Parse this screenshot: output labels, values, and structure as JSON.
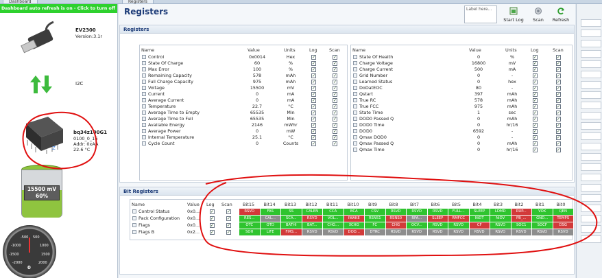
{
  "tabs": [
    {
      "label": "Dashboard"
    },
    {
      "label": "Registers"
    }
  ],
  "left": {
    "refresh_banner": "Dashboard auto refresh is on - Click to turn off",
    "adapter_name": "EV2300",
    "adapter_version": "Version:3.1r",
    "bus": "I2C",
    "chip_name": "bq34z100G1",
    "chip_rev": "0100_0_16",
    "chip_addr": "Addr: 0xAA",
    "chip_temp": "22.6 °C",
    "battery_voltage": "15500 mV",
    "battery_soc": "60%",
    "battery_level": 0.6,
    "gauge_labels": [
      "-500",
      "500",
      "-1000",
      "1000",
      "-1500",
      "1500",
      "-2000",
      "2000"
    ],
    "gauge_value": "0"
  },
  "main": {
    "title": "Registers",
    "label_placeholder": "Label here...",
    "start_log": "Start Log",
    "scan": "Scan",
    "refresh": "Refresh"
  },
  "registers": {
    "section_title": "Registers",
    "columns": [
      "Name",
      "Value",
      "Units",
      "Log",
      "Scan"
    ],
    "left_rows": [
      {
        "name": "Control",
        "value": "0x0014",
        "units": "Hex"
      },
      {
        "name": "State Of Charge",
        "value": "60",
        "units": "%"
      },
      {
        "name": "Max Error",
        "value": "100",
        "units": "%"
      },
      {
        "name": "Remaining Capacity",
        "value": "578",
        "units": "mAh"
      },
      {
        "name": "Full Charge Capacity",
        "value": "975",
        "units": "mAh"
      },
      {
        "name": "Voltage",
        "value": "15500",
        "units": "mV"
      },
      {
        "name": "Current",
        "value": "0",
        "units": "mA"
      },
      {
        "name": "Average Current",
        "value": "0",
        "units": "mA"
      },
      {
        "name": "Temperature",
        "value": "22.7",
        "units": "°C"
      },
      {
        "name": "Average Time to Empty",
        "value": "65535",
        "units": "Min"
      },
      {
        "name": "Average Time to Full",
        "value": "65535",
        "units": "Min"
      },
      {
        "name": "Available Energy",
        "value": "2146",
        "units": "mWhr"
      },
      {
        "name": "Average Power",
        "value": "0",
        "units": "mW"
      },
      {
        "name": "Internal Temperature",
        "value": "25.1",
        "units": "°C"
      },
      {
        "name": "Cycle Count",
        "value": "0",
        "units": "Counts"
      }
    ],
    "right_rows": [
      {
        "name": "State Of Health",
        "value": "0",
        "units": "%"
      },
      {
        "name": "Charge Voltage",
        "value": "16800",
        "units": "mV"
      },
      {
        "name": "Charge Current",
        "value": "500",
        "units": "mA"
      },
      {
        "name": "Grid Number",
        "value": "0",
        "units": "-"
      },
      {
        "name": "Learned Status",
        "value": "0",
        "units": "hex"
      },
      {
        "name": "DoDatEOC",
        "value": "80",
        "units": "-"
      },
      {
        "name": "Qstart",
        "value": "397",
        "units": "mAh"
      },
      {
        "name": "True RC",
        "value": "578",
        "units": "mAh"
      },
      {
        "name": "True FCC",
        "value": "975",
        "units": "mAh"
      },
      {
        "name": "State Time",
        "value": "1",
        "units": "sec"
      },
      {
        "name": "DOD0 Passed Q",
        "value": "0",
        "units": "mAh"
      },
      {
        "name": "DOD0 Time",
        "value": "0",
        "units": "hr/16"
      },
      {
        "name": "DOD0",
        "value": "6592",
        "units": "-"
      },
      {
        "name": "Qmax DOD0",
        "value": "0",
        "units": "-"
      },
      {
        "name": "Qmax Passed Q",
        "value": "0",
        "units": "mAh"
      },
      {
        "name": "Qmax Time",
        "value": "0",
        "units": "hr/16"
      }
    ]
  },
  "bit_registers": {
    "section_title": "Bit Registers",
    "columns": [
      "Name",
      "Value",
      "Log",
      "Scan",
      "Bit15",
      "Bit14",
      "Bit13",
      "Bit12",
      "Bit11",
      "Bit10",
      "Bit9",
      "Bit8",
      "Bit7",
      "Bit6",
      "Bit5",
      "Bit4",
      "Bit3",
      "Bit2",
      "Bit1",
      "Bit0"
    ],
    "rows": [
      {
        "name": "Control Status",
        "value": "0x0...",
        "bits": [
          {
            "t": "RSVD",
            "c": "r"
          },
          {
            "t": "FAS",
            "c": "g"
          },
          {
            "t": "SS",
            "c": "g"
          },
          {
            "t": "CALEN",
            "c": "g"
          },
          {
            "t": "CCA",
            "c": "g"
          },
          {
            "t": "BCA",
            "c": "g"
          },
          {
            "t": "CSV",
            "c": "g"
          },
          {
            "t": "RSVD",
            "c": "g"
          },
          {
            "t": "RSVD",
            "c": "g"
          },
          {
            "t": "RSVD",
            "c": "g"
          },
          {
            "t": "FULL...",
            "c": "g"
          },
          {
            "t": "SLEEP",
            "c": "g"
          },
          {
            "t": "LDMD",
            "c": "g"
          },
          {
            "t": "RUP...",
            "c": "r"
          },
          {
            "t": "VOK",
            "c": "g"
          },
          {
            "t": "QEN",
            "c": "g"
          }
        ]
      },
      {
        "name": "Pack Configuration",
        "value": "0x0...",
        "bits": [
          {
            "t": "RES...",
            "c": "g"
          },
          {
            "t": "CAL...",
            "c": "x"
          },
          {
            "t": "SCA...",
            "c": "g"
          },
          {
            "t": "RSVD",
            "c": "r"
          },
          {
            "t": "VOL...",
            "c": "g"
          },
          {
            "t": "IWAKE",
            "c": "r"
          },
          {
            "t": "RSNS1",
            "c": "g"
          },
          {
            "t": "RSNS0",
            "c": "r"
          },
          {
            "t": "RFA...",
            "c": "x"
          },
          {
            "t": "SLEEP",
            "c": "r"
          },
          {
            "t": "RMFCC",
            "c": "r"
          },
          {
            "t": "NiDT",
            "c": "g"
          },
          {
            "t": "NiDV",
            "c": "g"
          },
          {
            "t": "PB_...",
            "c": "r"
          },
          {
            "t": "GND...",
            "c": "g"
          },
          {
            "t": "TEMPS",
            "c": "r"
          }
        ]
      },
      {
        "name": "Flags",
        "value": "0x0...",
        "bits": [
          {
            "t": "OTC",
            "c": "g"
          },
          {
            "t": "OTD",
            "c": "g"
          },
          {
            "t": "BATHI",
            "c": "g"
          },
          {
            "t": "BAT...",
            "c": "g"
          },
          {
            "t": "CHG...",
            "c": "g"
          },
          {
            "t": "XCHG",
            "c": "g"
          },
          {
            "t": "FC",
            "c": "g"
          },
          {
            "t": "CHG",
            "c": "r"
          },
          {
            "t": "OCV...",
            "c": "g"
          },
          {
            "t": "RSVD",
            "c": "g"
          },
          {
            "t": "RSVD",
            "c": "g"
          },
          {
            "t": "CF",
            "c": "r"
          },
          {
            "t": "RSVD",
            "c": "g"
          },
          {
            "t": "SOC1",
            "c": "g"
          },
          {
            "t": "SOCF",
            "c": "g"
          },
          {
            "t": "DSG",
            "c": "r"
          }
        ]
      },
      {
        "name": "Flags B",
        "value": "0x2...",
        "bits": [
          {
            "t": "SOH",
            "c": "g"
          },
          {
            "t": "LIFE",
            "c": "g"
          },
          {
            "t": "FIRS...",
            "c": "r"
          },
          {
            "t": "RSVD",
            "c": "x"
          },
          {
            "t": "RSVD",
            "c": "x"
          },
          {
            "t": "DOD...",
            "c": "r"
          },
          {
            "t": "DTRC",
            "c": "x"
          },
          {
            "t": "RSVD",
            "c": "x"
          },
          {
            "t": "RSVD",
            "c": "x"
          },
          {
            "t": "RSVD",
            "c": "x"
          },
          {
            "t": "RSVD",
            "c": "x"
          },
          {
            "t": "RSVD",
            "c": "x"
          },
          {
            "t": "RSVD",
            "c": "x"
          },
          {
            "t": "RSVD",
            "c": "x"
          },
          {
            "t": "RSVD",
            "c": "x"
          },
          {
            "t": "RSVD",
            "c": "x"
          }
        ]
      }
    ]
  },
  "colors": {
    "banner": "#2ed12e",
    "bit_on": "#2fc42f",
    "bit_off": "#d23a3a",
    "bit_disabled": "#8d8d8d",
    "annotation": "#e01010",
    "title": "#1d3c78"
  },
  "icons": [
    "usb-cable-icon",
    "transfer-arrows-icon",
    "chip-icon",
    "battery-icon",
    "current-gauge-icon",
    "start-log-icon",
    "scan-icon",
    "refresh-icon",
    "register-row-icon",
    "checkbox-checked-icon"
  ]
}
